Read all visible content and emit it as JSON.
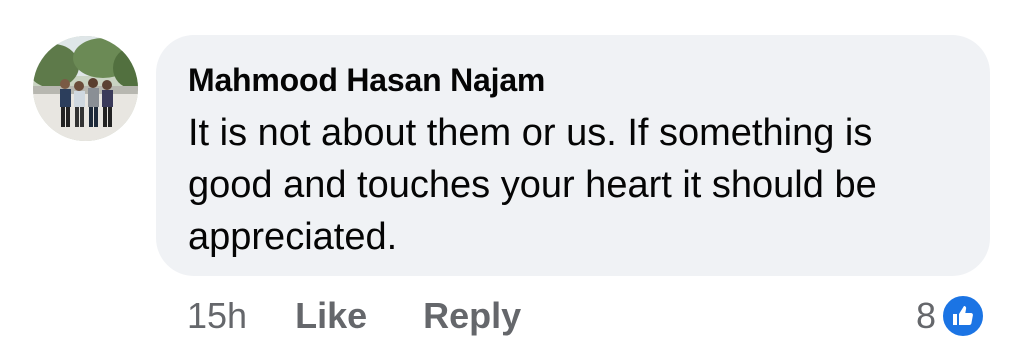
{
  "comment": {
    "author": "Mahmood Hasan Najam",
    "text": "It is not about them or us. If something is good and touches your heart it should be appreciated.",
    "time": "15h",
    "like_label": "Like",
    "reply_label": "Reply",
    "reaction_count": "8",
    "reaction_icon": "thumbs-up-icon"
  },
  "colors": {
    "bubble": "#f0f2f5",
    "text": "#050505",
    "secondary": "#65676b",
    "like_blue": "#1b74e4"
  }
}
